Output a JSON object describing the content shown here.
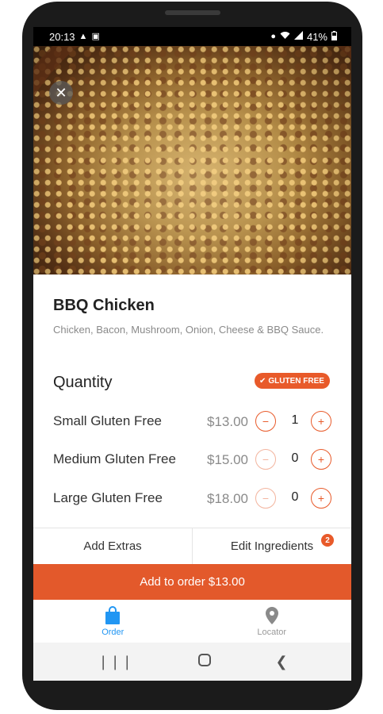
{
  "status_bar": {
    "time": "20:13",
    "battery": "41%",
    "icons": [
      "notification-icon",
      "photo-icon",
      "location-icon",
      "wifi-icon",
      "signal-icon",
      "battery-icon"
    ]
  },
  "product": {
    "name": "BBQ Chicken",
    "description": "Chicken, Bacon, Mushroom, Onion, Cheese & BBQ Sauce."
  },
  "quantity": {
    "title": "Quantity",
    "badge": "GLUTEN FREE",
    "sizes": [
      {
        "label": "Small Gluten Free",
        "price": "$13.00",
        "qty": "1",
        "minus_enabled": true
      },
      {
        "label": "Medium Gluten Free",
        "price": "$15.00",
        "qty": "0",
        "minus_enabled": false
      },
      {
        "label": "Large Gluten Free",
        "price": "$18.00",
        "qty": "0",
        "minus_enabled": false
      }
    ]
  },
  "actions": {
    "add_extras": "Add Extras",
    "edit_ingredients": "Edit Ingredients",
    "ingredients_count": "2"
  },
  "order_button": "Add to order $13.00",
  "bottom_nav": {
    "items": [
      {
        "label": "Order",
        "icon": "shopping-bag-icon",
        "active": true
      },
      {
        "label": "Locator",
        "icon": "location-pin-icon",
        "active": false
      }
    ]
  },
  "colors": {
    "accent": "#e3592b",
    "nav_active": "#2196f3"
  }
}
